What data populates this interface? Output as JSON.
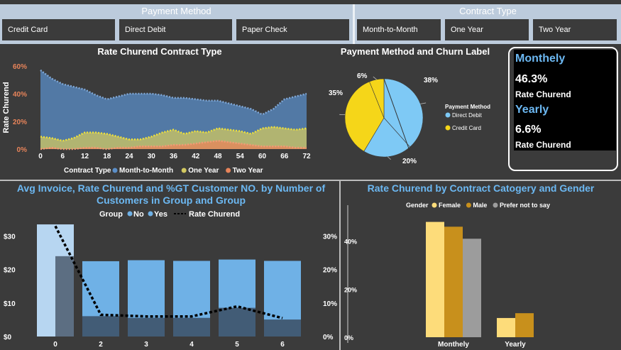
{
  "slicers": {
    "payment": {
      "title": "Payment Method",
      "items": [
        "Credit Card",
        "Direct Debit",
        "Paper Check"
      ]
    },
    "contract": {
      "title": "Contract Type",
      "items": [
        "Month-to-Month",
        "One Year",
        "Two Year"
      ]
    }
  },
  "kpi": {
    "monthly_head": "Monthely",
    "monthly_value": "46.3%",
    "monthly_label": "Rate Churend",
    "yearly_head": "Yearly",
    "yearly_value": "6.6%",
    "yearly_label": "Rate Churend"
  },
  "colors": {
    "month": "#5b8fc9",
    "one_year": "#d2c860",
    "two_year": "#e8845a",
    "direct_debit": "#7ec9f5",
    "credit_card": "#f5d619",
    "bar_no": "#6fb1e6",
    "bar_yes": "#b7d6f1",
    "female": "#fddc7a",
    "male": "#c8901c",
    "prefer": "#9c9c9c",
    "title_blue": "#6cb8f2"
  },
  "chart_data": [
    {
      "type": "area",
      "title": "Rate Churend Contract Type",
      "ylabel": "Rate Churend",
      "ylim": [
        0,
        60
      ],
      "y_ticks": [
        "0%",
        "20%",
        "40%",
        "60%"
      ],
      "x_ticks": [
        "0",
        "6",
        "12",
        "18",
        "24",
        "30",
        "36",
        "42",
        "48",
        "54",
        "60",
        "66",
        "72"
      ],
      "x": [
        0,
        3,
        6,
        9,
        12,
        15,
        18,
        21,
        24,
        27,
        30,
        33,
        36,
        39,
        42,
        45,
        48,
        51,
        54,
        57,
        60,
        63,
        66,
        69,
        72
      ],
      "legend_title": "Contract Type",
      "series": [
        {
          "name": "Month-to-Month",
          "values": [
            57,
            51,
            47,
            45,
            43,
            39,
            36,
            38,
            40,
            40,
            40,
            39,
            37,
            37,
            36,
            35,
            35,
            33,
            31,
            29,
            25,
            29,
            36,
            38,
            40
          ]
        },
        {
          "name": "One Year",
          "values": [
            9,
            8,
            6,
            8,
            12,
            12,
            11,
            9,
            7,
            7,
            9,
            12,
            14,
            11,
            13,
            12,
            15,
            14,
            13,
            11,
            15,
            16,
            15,
            14,
            15
          ]
        },
        {
          "name": "Two Year",
          "values": [
            0,
            1,
            0,
            0,
            1,
            1,
            0,
            1,
            1,
            2,
            2,
            2,
            3,
            3,
            4,
            5,
            6,
            5,
            4,
            3,
            2,
            2,
            2,
            1,
            1
          ]
        }
      ]
    },
    {
      "type": "pie",
      "title": "Payment Method and Churn Label",
      "legend_title": "Payment Method",
      "legend": [
        "Direct Debit",
        "Credit Card"
      ],
      "slices": [
        {
          "label": "38%",
          "value": 38,
          "series": "Direct Debit"
        },
        {
          "label": "20%",
          "value": 20,
          "series": "Direct Debit"
        },
        {
          "label": "35%",
          "value": 35,
          "series": "Credit Card"
        },
        {
          "label": "6%",
          "value": 6,
          "series": "Credit Card"
        }
      ]
    },
    {
      "type": "bar",
      "title": "Avg Invoice, Rate Churend and %GT Customer NO. by Number of Customers in Group and Group",
      "legend_title": "Group",
      "legend": [
        "No",
        "Yes",
        "Rate Churend"
      ],
      "categories": [
        "0",
        "2",
        "3",
        "4",
        "5",
        "6"
      ],
      "series": [
        {
          "name": "No",
          "values": [
            24,
            22.5,
            22.8,
            22.6,
            23,
            22.6
          ]
        },
        {
          "name": "Yes",
          "values": [
            33.5,
            0,
            0,
            0,
            0,
            0
          ]
        }
      ],
      "line": {
        "name": "Rate Churend",
        "values": [
          33,
          6.5,
          6,
          6,
          9,
          5.5
        ]
      },
      "y_left_ticks": [
        "$0",
        "$10",
        "$20",
        "$30"
      ],
      "y_right_ticks": [
        "0%",
        "10%",
        "20%",
        "30%"
      ],
      "ylim_left": [
        0,
        35
      ],
      "ylim_right": [
        0,
        35
      ]
    },
    {
      "type": "bar",
      "title": "Rate Churend by Contract Catogery and Gender",
      "legend_title": "Gender",
      "legend": [
        "Female",
        "Male",
        "Prefer not to say"
      ],
      "categories": [
        "Monthely",
        "Yearly"
      ],
      "series": [
        {
          "name": "Female",
          "values": [
            48,
            8
          ]
        },
        {
          "name": "Male",
          "values": [
            46,
            10
          ]
        },
        {
          "name": "Prefer not to say",
          "values": [
            41,
            0
          ]
        }
      ],
      "y_ticks": [
        "0%",
        "20%",
        "40%"
      ],
      "ylim": [
        0,
        50
      ]
    }
  ]
}
